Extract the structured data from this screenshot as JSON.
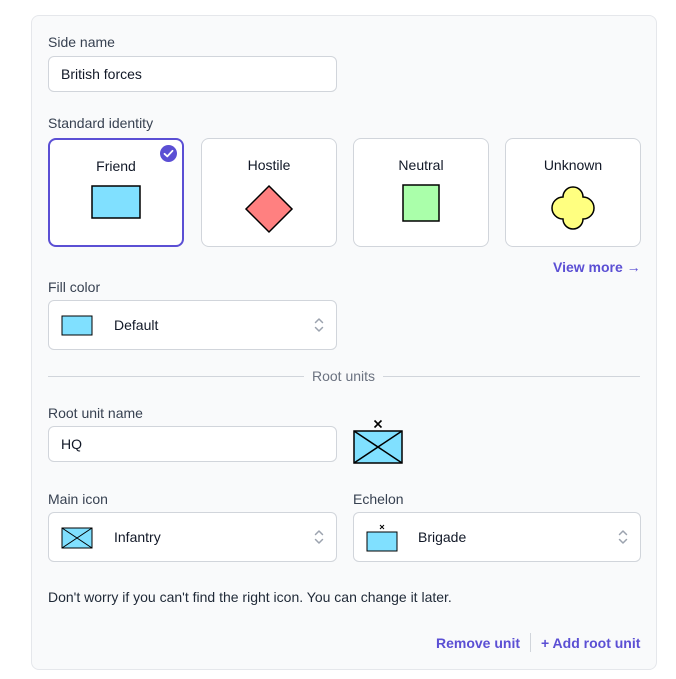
{
  "side": {
    "name_label": "Side name",
    "name_value": "British forces",
    "identity_label": "Standard identity",
    "identities": [
      {
        "label": "Friend",
        "selected": true,
        "color": "#80e0ff"
      },
      {
        "label": "Hostile",
        "selected": false,
        "color": "#ff8080"
      },
      {
        "label": "Neutral",
        "selected": false,
        "color": "#aaffaa"
      },
      {
        "label": "Unknown",
        "selected": false,
        "color": "#ffff80"
      }
    ],
    "view_more": "View more →",
    "fill_label": "Fill color",
    "fill_value": "Default"
  },
  "root_units": {
    "divider_label": "Root units",
    "unit_name_label": "Root unit name",
    "unit_name_value": "HQ",
    "main_icon_label": "Main icon",
    "main_icon_value": "Infantry",
    "echelon_label": "Echelon",
    "echelon_value": "Brigade",
    "echelon_mark": "×",
    "note": "Don't worry if you can't find the right icon. You can change it later.",
    "remove_label": "Remove unit",
    "add_label": "+ Add root unit"
  },
  "colors": {
    "accent": "#5b4fd4",
    "friend_fill": "#80e0ff"
  },
  "icons": [
    "check-icon",
    "chevron-updown-icon",
    "infantry-symbol-icon",
    "brigade-symbol-icon"
  ]
}
